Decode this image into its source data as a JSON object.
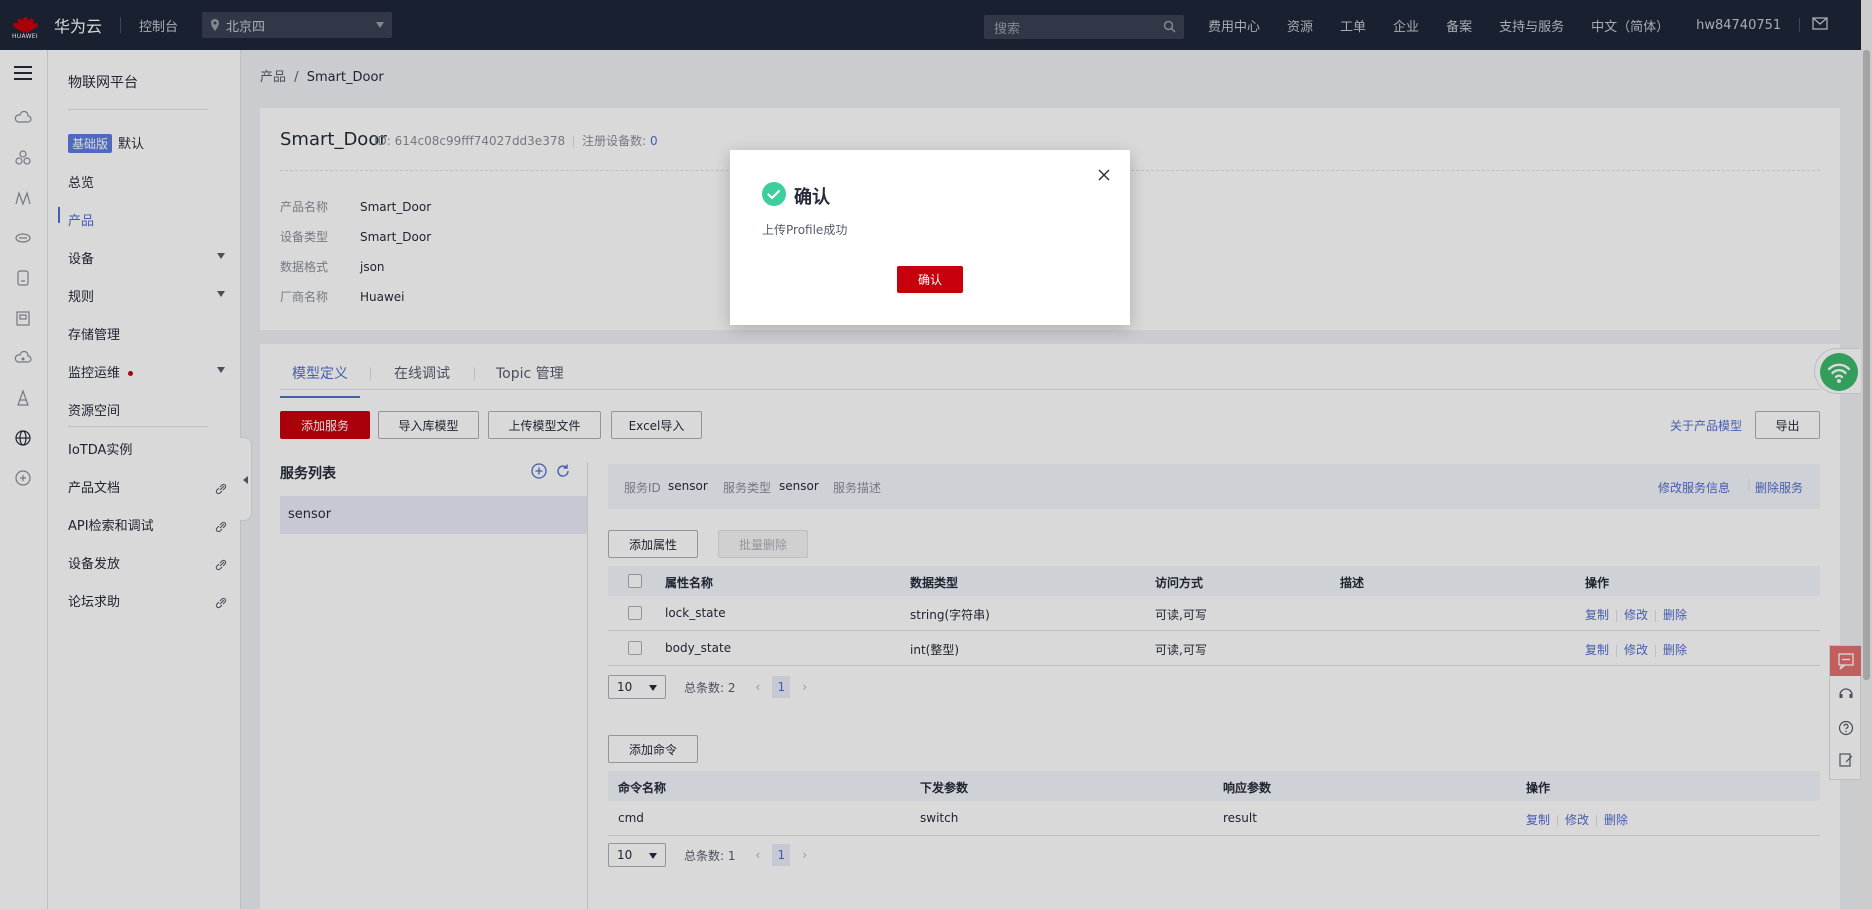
{
  "topbar": {
    "logo_text": "HUAWEI",
    "brand": "华为云",
    "console": "控制台",
    "region": "北京四",
    "search_placeholder": "搜索",
    "nav": [
      "费用中心",
      "资源",
      "工单",
      "企业",
      "备案",
      "支持与服务",
      "中文（简体）",
      "hw84740751"
    ]
  },
  "sidebar": {
    "title": "物联网平台",
    "edition_tag": "基础版",
    "edition_value": "默认",
    "items": [
      "总览",
      "产品",
      "设备",
      "规则",
      "存储管理",
      "监控运维",
      "资源空间",
      "IoTDA实例",
      "产品文档",
      "API检索和调试",
      "设备发放",
      "论坛求助"
    ]
  },
  "breadcrumb": {
    "parent": "产品",
    "sep": "/",
    "current": "Smart_Door"
  },
  "product": {
    "name": "Smart_Door",
    "id_text": "ID: 614c08c99fff74027dd3e378",
    "registered_label": "注册设备数:",
    "registered_value": "0",
    "fields": [
      {
        "k": "产品名称",
        "v": "Smart_Door"
      },
      {
        "k": "设备类型",
        "v": "Smart_Door"
      },
      {
        "k": "数据格式",
        "v": "json"
      },
      {
        "k": "厂商名称",
        "v": "Huawei"
      }
    ]
  },
  "tabs": [
    "模型定义",
    "在线调试",
    "Topic 管理"
  ],
  "toolbar": {
    "add_service": "添加服务",
    "import_lib": "导入库模型",
    "upload_model": "上传模型文件",
    "excel_import": "Excel导入",
    "about_model": "关于产品模型",
    "export": "导出"
  },
  "service_list": {
    "title": "服务列表",
    "items": [
      "sensor"
    ]
  },
  "service_bar": {
    "id_label": "服务ID",
    "id_value": "sensor",
    "type_label": "服务类型",
    "type_value": "sensor",
    "desc_label": "服务描述",
    "edit": "修改服务信息",
    "delete": "删除服务"
  },
  "properties": {
    "add_btn": "添加属性",
    "batch_delete": "批量删除",
    "headers": [
      "属性名称",
      "数据类型",
      "访问方式",
      "描述",
      "操作"
    ],
    "rows": [
      {
        "name": "lock_state",
        "type": "string(字符串)",
        "access": "可读,可写",
        "desc": ""
      },
      {
        "name": "body_state",
        "type": "int(整型)",
        "access": "可读,可写",
        "desc": ""
      }
    ],
    "ops": [
      "复制",
      "修改",
      "删除"
    ],
    "page_size": "10",
    "total": "总条数: 2",
    "page": "1"
  },
  "commands": {
    "add_btn": "添加命令",
    "headers": [
      "命令名称",
      "下发参数",
      "响应参数",
      "操作"
    ],
    "rows": [
      {
        "name": "cmd",
        "down": "switch",
        "resp": "result"
      }
    ],
    "ops": [
      "复制",
      "修改",
      "删除"
    ],
    "page_size": "10",
    "total": "总条数: 1",
    "page": "1"
  },
  "modal": {
    "title": "确认",
    "message": "上传Profile成功",
    "confirm": "确认"
  },
  "colors": {
    "topbar": "#1e2638",
    "primary": "#c7000b",
    "link": "#526ecc",
    "success": "#3ccf9c"
  }
}
